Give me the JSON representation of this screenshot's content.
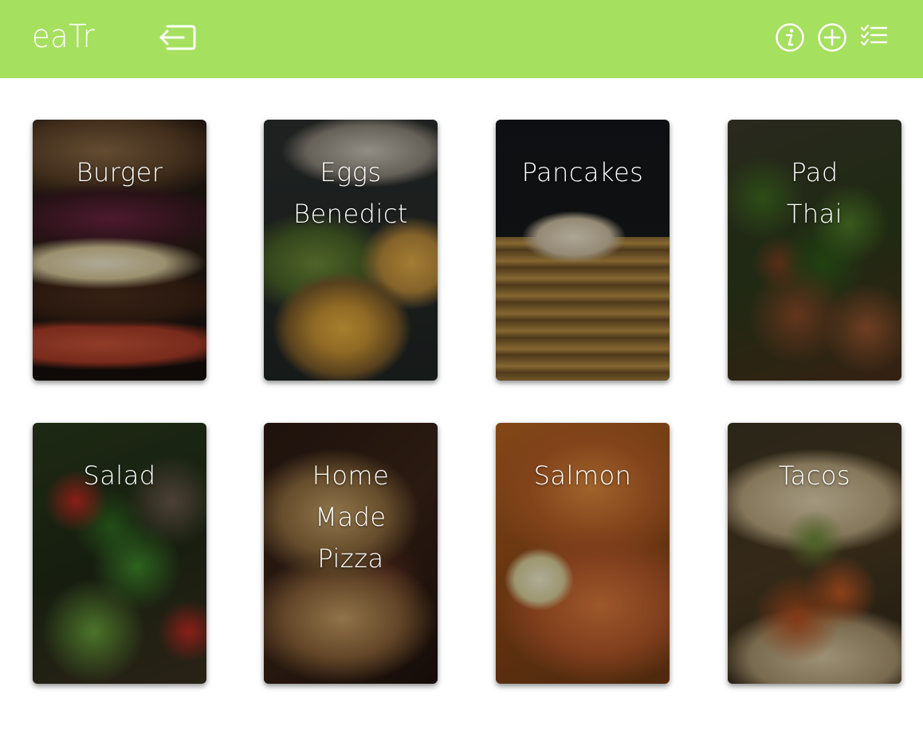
{
  "header": {
    "logo": "eaTr",
    "background": "#a6e05f",
    "icons": {
      "logout": "logout-icon",
      "info": "info-icon",
      "add": "add-icon",
      "list": "checklist-icon"
    }
  },
  "recipes": [
    {
      "title": "Burger"
    },
    {
      "title": "Eggs Benedict"
    },
    {
      "title": "Pancakes"
    },
    {
      "title": "Pad Thai"
    },
    {
      "title": "Salad"
    },
    {
      "title": "Home Made Pizza"
    },
    {
      "title": "Salmon"
    },
    {
      "title": "Tacos"
    }
  ]
}
